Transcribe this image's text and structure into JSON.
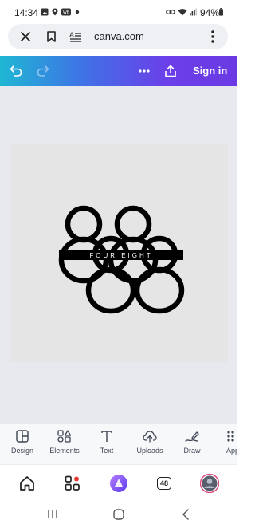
{
  "status_bar": {
    "time": "14:34",
    "battery": "94%",
    "icons": [
      "gallery-icon",
      "location-icon",
      "wb-icon",
      "dot-icon",
      "link-icon",
      "wifi-icon",
      "signal-icon",
      "battery-icon"
    ]
  },
  "browser": {
    "url": "canva.com",
    "close_icon": "close-icon",
    "bookmark_icon": "bookmark-icon",
    "reader_icon": "reader-mode-icon",
    "menu_icon": "more-vertical-icon"
  },
  "toolbar": {
    "sign_in_label": "Sign in",
    "icons": [
      "undo-icon",
      "redo-icon",
      "more-horizontal-icon",
      "share-icon"
    ]
  },
  "design": {
    "logo_text": "FOUR EIGHT"
  },
  "tools": [
    {
      "label": "Design",
      "icon": "design-icon"
    },
    {
      "label": "Elements",
      "icon": "elements-icon"
    },
    {
      "label": "Text",
      "icon": "text-icon"
    },
    {
      "label": "Uploads",
      "icon": "uploads-icon"
    },
    {
      "label": "Draw",
      "icon": "draw-icon"
    },
    {
      "label": "App",
      "icon": "apps-icon"
    }
  ],
  "browser_nav": {
    "tab_count": "48",
    "icons": [
      "home-icon",
      "services-icon",
      "alice-icon",
      "tabs-icon",
      "profile-avatar"
    ]
  },
  "colors": {
    "toolbar_gradient_start": "#1fb7d4",
    "toolbar_gradient_end": "#6b3ae3",
    "notification_dot": "#e53935",
    "alice_purple": "#8a4dff"
  }
}
